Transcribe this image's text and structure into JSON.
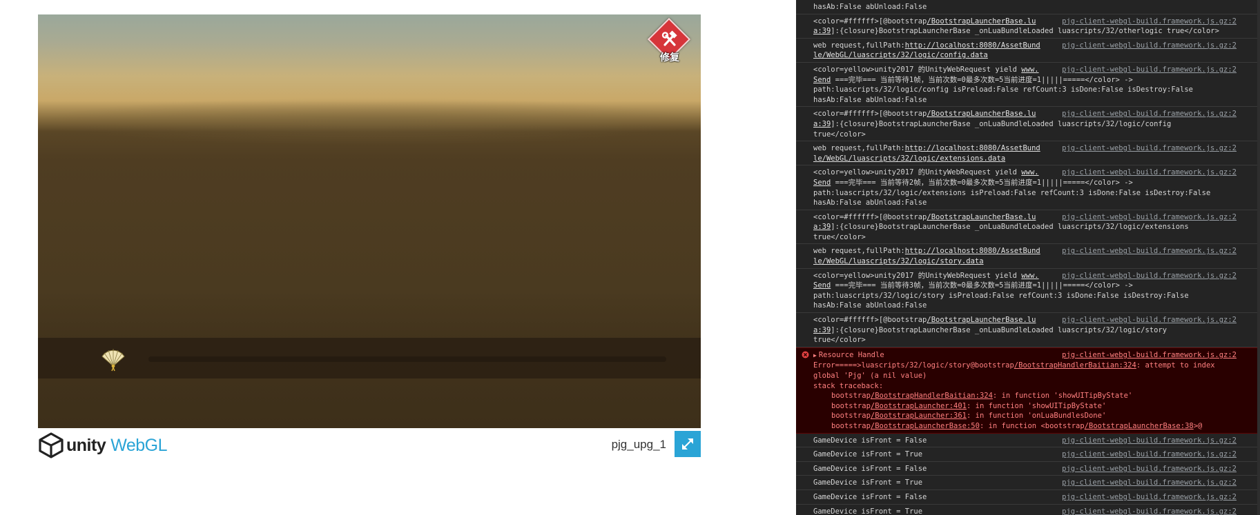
{
  "player": {
    "repair_label": "修复",
    "build_title": "pjg_upg_1",
    "logo_word": "unity",
    "logo_webgl": "WebGL",
    "icons": {
      "repair": "hammer-wrench-icon",
      "fan": "folding-fan-icon",
      "fullscreen": "fullscreen-icon",
      "unity": "unity-cube-icon"
    },
    "colors": {
      "accent": "#2aa4d6",
      "repair_badge": "#d6353a"
    }
  },
  "console": {
    "messages": [
      {
        "kind": "log",
        "source": "",
        "lines": [
          "hasAb:False abUnload:False"
        ]
      },
      {
        "kind": "log",
        "source": "pjg-client-webgl-build.framework.js.gz:2",
        "parts": [
          {
            "t": "<color=#ffffff>[@bootstrap"
          },
          {
            "l": "/BootstrapLauncherBase.lu"
          },
          {
            "t": "\n"
          },
          {
            "l": "a:39"
          },
          {
            "t": "]:{closure}BootstrapLauncherBase _onLuaBundleLoaded luascripts/32/otherlogic true</color>"
          }
        ]
      },
      {
        "kind": "log",
        "source": "pjg-client-webgl-build.framework.js.gz:2",
        "parts": [
          {
            "t": "web request,fullPath:"
          },
          {
            "l": "http://localhost:8080/AssetBund"
          },
          {
            "t": "\n"
          },
          {
            "l": "le/WebGL/luascripts/32/logic/config.data"
          }
        ]
      },
      {
        "kind": "log",
        "source": "pjg-client-webgl-build.framework.js.gz:2",
        "parts": [
          {
            "t": "<color=yellow>unity2017 的UnityWebRequest yield "
          },
          {
            "l": "www."
          },
          {
            "t": "\n"
          },
          {
            "l": "Send"
          },
          {
            "t": " ===完毕=== 当前等待1帧，当前次数=0最多次数=5当前进度=1|||||=====</color> ->\npath:luascripts/32/logic/config isPreload:False refCount:3 isDone:False isDestroy:False\nhasAb:False abUnload:False"
          }
        ]
      },
      {
        "kind": "log",
        "source": "pjg-client-webgl-build.framework.js.gz:2",
        "parts": [
          {
            "t": "<color=#ffffff>[@bootstrap"
          },
          {
            "l": "/BootstrapLauncherBase.lu"
          },
          {
            "t": "\n"
          },
          {
            "l": "a:39"
          },
          {
            "t": "]:{closure}BootstrapLauncherBase _onLuaBundleLoaded luascripts/32/logic/config\ntrue</color>"
          }
        ]
      },
      {
        "kind": "log",
        "source": "pjg-client-webgl-build.framework.js.gz:2",
        "parts": [
          {
            "t": "web request,fullPath:"
          },
          {
            "l": "http://localhost:8080/AssetBund"
          },
          {
            "t": "\n"
          },
          {
            "l": "le/WebGL/luascripts/32/logic/extensions.data"
          }
        ]
      },
      {
        "kind": "log",
        "source": "pjg-client-webgl-build.framework.js.gz:2",
        "parts": [
          {
            "t": "<color=yellow>unity2017 的UnityWebRequest yield "
          },
          {
            "l": "www."
          },
          {
            "t": "\n"
          },
          {
            "l": "Send"
          },
          {
            "t": " ===完毕=== 当前等待2帧，当前次数=0最多次数=5当前进度=1|||||=====</color> ->\npath:luascripts/32/logic/extensions isPreload:False refCount:3 isDone:False isDestroy:False\nhasAb:False abUnload:False"
          }
        ]
      },
      {
        "kind": "log",
        "source": "pjg-client-webgl-build.framework.js.gz:2",
        "parts": [
          {
            "t": "<color=#ffffff>[@bootstrap"
          },
          {
            "l": "/BootstrapLauncherBase.lu"
          },
          {
            "t": "\n"
          },
          {
            "l": "a:39"
          },
          {
            "t": "]:{closure}BootstrapLauncherBase _onLuaBundleLoaded luascripts/32/logic/extensions\ntrue</color>"
          }
        ]
      },
      {
        "kind": "log",
        "source": "pjg-client-webgl-build.framework.js.gz:2",
        "parts": [
          {
            "t": "web request,fullPath:"
          },
          {
            "l": "http://localhost:8080/AssetBund"
          },
          {
            "t": "\n"
          },
          {
            "l": "le/WebGL/luascripts/32/logic/story.data"
          }
        ]
      },
      {
        "kind": "log",
        "source": "pjg-client-webgl-build.framework.js.gz:2",
        "parts": [
          {
            "t": "<color=yellow>unity2017 的UnityWebRequest yield "
          },
          {
            "l": "www."
          },
          {
            "t": "\n"
          },
          {
            "l": "Send"
          },
          {
            "t": " ===完毕=== 当前等待3帧，当前次数=0最多次数=5当前进度=1|||||=====</color> ->\npath:luascripts/32/logic/story isPreload:False refCount:3 isDone:False isDestroy:False\nhasAb:False abUnload:False"
          }
        ]
      },
      {
        "kind": "log",
        "source": "pjg-client-webgl-build.framework.js.gz:2",
        "parts": [
          {
            "t": "<color=#ffffff>[@bootstrap"
          },
          {
            "l": "/BootstrapLauncherBase.lu"
          },
          {
            "t": "\n"
          },
          {
            "l": "a:39"
          },
          {
            "t": "]:{closure}BootstrapLauncherBase _onLuaBundleLoaded luascripts/32/logic/story\ntrue</color>"
          }
        ]
      },
      {
        "kind": "error",
        "source": "pjg-client-webgl-build.framework.js.gz:2",
        "parts": [
          {
            "t": "Resource Handle\nError=====>luascripts/32/logic/story@bootstrap"
          },
          {
            "l": "/BootstrapHandlerBaitian:324"
          },
          {
            "t": ": attempt to index\nglobal 'Pjg' (a nil value)\nstack traceback:"
          }
        ],
        "trace": [
          [
            {
              "t": "bootstrap"
            },
            {
              "l": "/BootstrapHandlerBaitian:324"
            },
            {
              "t": ": in function 'showUITipByState'"
            }
          ],
          [
            {
              "t": "bootstrap"
            },
            {
              "l": "/BootstrapLauncher:401"
            },
            {
              "t": ": in function 'showUITipByState'"
            }
          ],
          [
            {
              "t": "bootstrap"
            },
            {
              "l": "/BootstrapLauncher:361"
            },
            {
              "t": ": in function 'onLuaBundlesDone'"
            }
          ],
          [
            {
              "t": "bootstrap"
            },
            {
              "l": "/BootstrapLauncherBase:50"
            },
            {
              "t": ": in function <bootstrap"
            },
            {
              "l": "/BootstrapLauncherBase:38"
            },
            {
              "t": ">@"
            }
          ]
        ]
      },
      {
        "kind": "log",
        "source": "pjg-client-webgl-build.framework.js.gz:2",
        "parts": [
          {
            "t": "GameDevice isFront = False"
          }
        ]
      },
      {
        "kind": "log",
        "source": "pjg-client-webgl-build.framework.js.gz:2",
        "parts": [
          {
            "t": "GameDevice isFront = True"
          }
        ]
      },
      {
        "kind": "log",
        "source": "pjg-client-webgl-build.framework.js.gz:2",
        "parts": [
          {
            "t": "GameDevice isFront = False"
          }
        ]
      },
      {
        "kind": "log",
        "source": "pjg-client-webgl-build.framework.js.gz:2",
        "parts": [
          {
            "t": "GameDevice isFront = True"
          }
        ]
      },
      {
        "kind": "log",
        "source": "pjg-client-webgl-build.framework.js.gz:2",
        "parts": [
          {
            "t": "GameDevice isFront = False"
          }
        ]
      },
      {
        "kind": "log",
        "source": "pjg-client-webgl-build.framework.js.gz:2",
        "parts": [
          {
            "t": "GameDevice isFront = True"
          }
        ]
      }
    ]
  }
}
